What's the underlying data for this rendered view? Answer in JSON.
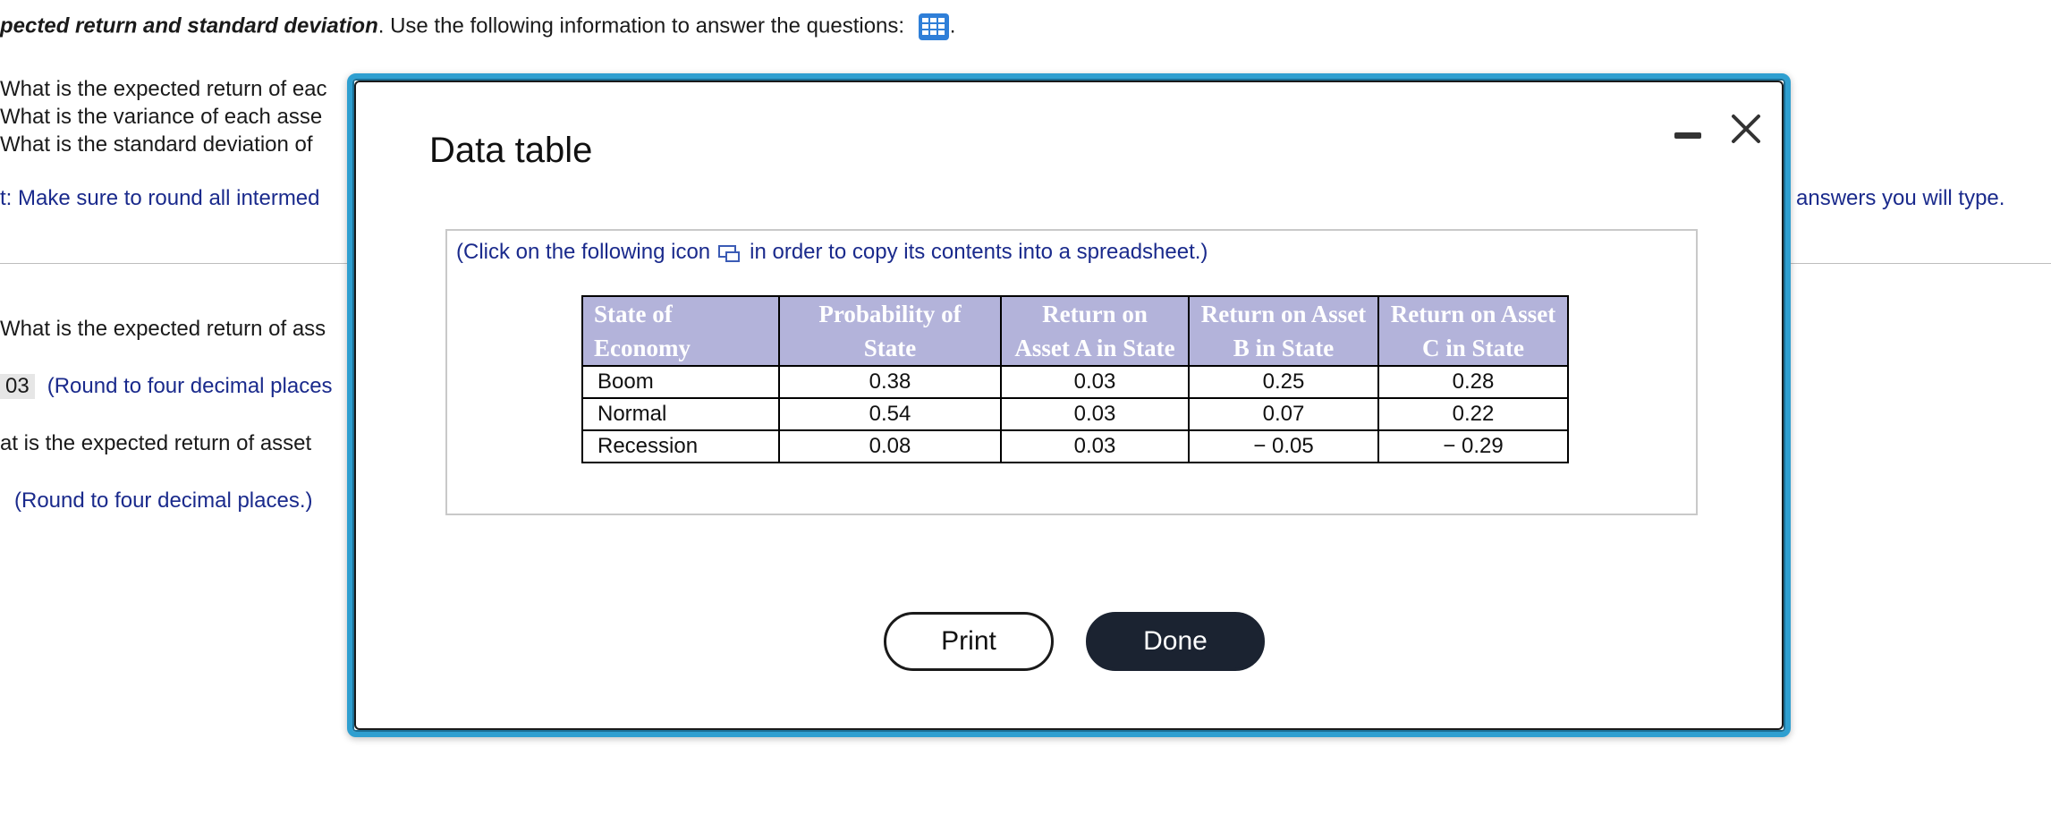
{
  "background": {
    "header_bold": "pected return and standard deviation",
    "header_rest": ".  Use the following information to answer the questions:",
    "header_end": ".",
    "q1": "What is the expected return of eac",
    "q2": "What is the variance of each asse",
    "q3": "What is the standard deviation of",
    "hint_left": "t: Make sure to round all intermed",
    "hint_right": "answers you will type.",
    "part_a": "What is the expected return of ass",
    "answer_value": "03",
    "round_a": "(Round to four decimal places",
    "part_b": "at is the expected return of asset",
    "round_b": "(Round to four decimal places.)"
  },
  "modal": {
    "title": "Data table",
    "copy_note_before": "(Click on the following icon",
    "copy_note_after": "in order to copy its contents into a spreadsheet.)",
    "print_label": "Print",
    "done_label": "Done"
  },
  "table": {
    "headers": [
      "State of Economy",
      "Probability of State",
      "Return on Asset A in State",
      "Return on Asset B in State",
      "Return on Asset C in State"
    ],
    "rows": [
      [
        "Boom",
        "0.38",
        "0.03",
        "0.25",
        "0.28"
      ],
      [
        "Normal",
        "0.54",
        "0.03",
        "0.07",
        "0.22"
      ],
      [
        "Recession",
        "0.08",
        "0.03",
        "− 0.05",
        "− 0.29"
      ]
    ]
  },
  "colors": {
    "header_bg": "#b3b3da",
    "modal_border": "#2f9fd0",
    "done_bg": "#1b2331",
    "link_text": "#1a2a8c"
  },
  "icons": [
    "table-grid-icon",
    "copy-spreadsheet-icon",
    "minimize-icon",
    "close-icon"
  ]
}
